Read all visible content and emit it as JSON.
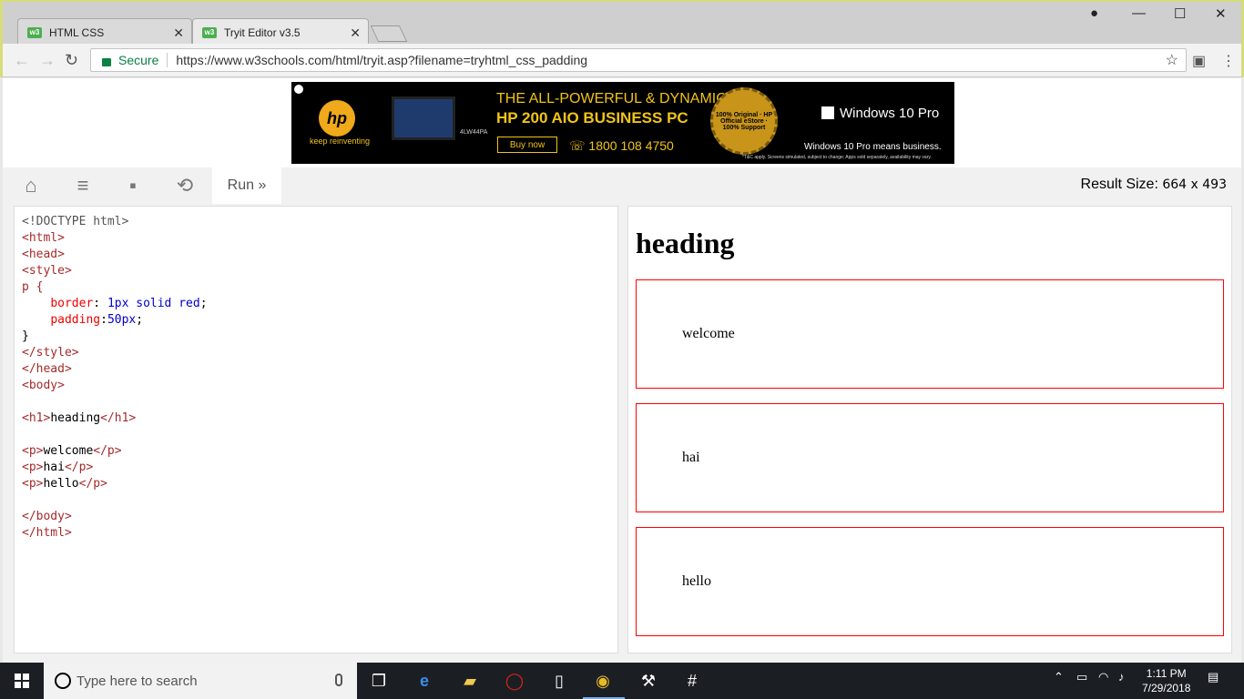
{
  "browser": {
    "tabs": [
      {
        "label": "HTML CSS",
        "favicon": "w3"
      },
      {
        "label": "Tryit Editor v3.5",
        "favicon": "w3"
      }
    ],
    "window_controls": {
      "minimize": "—",
      "maximize": "☐",
      "close": "✕"
    },
    "address": {
      "secure_label": "Secure",
      "url": "https://www.w3schools.com/html/tryit.asp?filename=tryhtml_css_padding"
    }
  },
  "ad": {
    "brand_tagline": "keep reinventing",
    "model_code": "4LW44PA",
    "headline1": "THE ALL-POWERFUL & DYNAMIC",
    "headline2": "HP 200 AIO BUSINESS PC",
    "buy_label": "Buy now",
    "phone": "1800 108 4750",
    "seal_text": "100% Original · HP Official eStore · 100% Support",
    "os_label": "Windows 10 Pro",
    "os_tagline": "Windows 10 Pro means business.",
    "fine_print": "*T&C apply. Screens simulated, subject to change; Apps sold separately, availability may vary."
  },
  "tryit": {
    "run_label": "Run »",
    "result_size_label": "Result Size:",
    "result_size_value": "664 x 493"
  },
  "code": {
    "lines": [
      "<!DOCTYPE html>",
      "<html>",
      "<head>",
      "<style>",
      "p {",
      "    border: 1px solid red;",
      "    padding:50px;",
      "}",
      "</style>",
      "</head>",
      "<body>",
      "",
      "<h1>heading</h1>",
      "",
      "<p>welcome</p>",
      "<p>hai</p>",
      "<p>hello</p>",
      "",
      "</body>",
      "</html>"
    ]
  },
  "result": {
    "heading": "heading",
    "paragraphs": [
      "welcome",
      "hai",
      "hello"
    ]
  },
  "taskbar": {
    "search_placeholder": "Type here to search",
    "time": "1:11 PM",
    "date": "7/29/2018"
  },
  "colors": {
    "accent_green": "#4caf50",
    "secure_green": "#0b8043",
    "border_red": "#ff0000"
  }
}
